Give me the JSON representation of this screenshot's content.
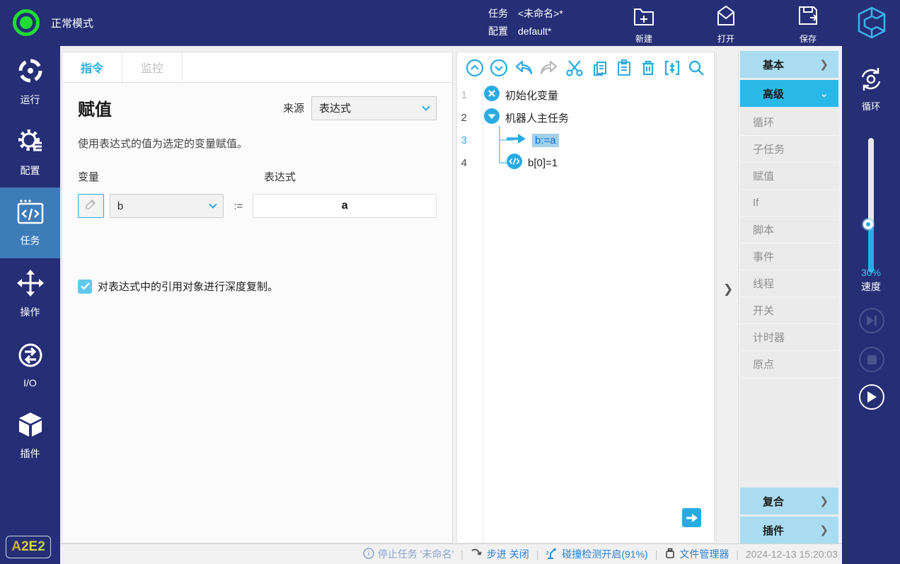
{
  "topbar": {
    "mode": "正常模式",
    "task_label": "任务",
    "task_value": "<未命名>*",
    "config_label": "配置",
    "config_value": "default*",
    "actions": [
      {
        "label": "新建"
      },
      {
        "label": "打开"
      },
      {
        "label": "保存"
      }
    ]
  },
  "sidebar": {
    "items": [
      {
        "label": "运行"
      },
      {
        "label": "配置"
      },
      {
        "label": "任务"
      },
      {
        "label": "操作"
      },
      {
        "label": "I/O"
      },
      {
        "label": "插件"
      }
    ],
    "badge": "A2E2"
  },
  "form": {
    "tabs": [
      {
        "label": "指令"
      },
      {
        "label": "监控"
      }
    ],
    "title": "赋值",
    "source_label": "来源",
    "source_value": "表达式",
    "description": "使用表达式的值为选定的变量赋值。",
    "variable_label": "变量",
    "expression_label": "表达式",
    "variable_value": "b",
    "assign_symbol": ":=",
    "expression_value": "a",
    "checkbox_label": "对表达式中的引用对象进行深度复制。",
    "checkbox_checked": true
  },
  "tree": {
    "toolbar_icons": [
      "move-up",
      "move-down",
      "undo",
      "redo",
      "cut",
      "copy",
      "paste",
      "delete",
      "collapse",
      "search"
    ],
    "rows": [
      {
        "num": "1",
        "icon": "init-variable-icon",
        "label": "初始化变量"
      },
      {
        "num": "2",
        "icon": "main-task-icon",
        "label": "机器人主任务"
      },
      {
        "num": "3",
        "icon": "assign-arrow-icon",
        "label": "b:=a",
        "selected": true
      },
      {
        "num": "4",
        "icon": "script-icon",
        "label": "b[0]=1"
      }
    ]
  },
  "categories": {
    "groups": [
      {
        "label": "基本"
      },
      {
        "label": "高级"
      }
    ],
    "items": [
      "循环",
      "子任务",
      "赋值",
      "If",
      "脚本",
      "事件",
      "线程",
      "开关",
      "计时器",
      "原点"
    ],
    "bottom_groups": [
      {
        "label": "复合"
      },
      {
        "label": "插件"
      }
    ]
  },
  "right_panel": {
    "loop_label": "循环",
    "speed_value": "30%",
    "speed_label": "速度"
  },
  "status_bar": {
    "stop_task": "停止任务 '未命名'",
    "step_label": "步进 关闭",
    "collision": "碰撞检测开启(91%)",
    "file_manager": "文件管理器",
    "timestamp": "2024-12-13 15:20:03"
  },
  "colors": {
    "accent": "#29abe2",
    "navy": "#262e76",
    "sidebar_active": "#3e7cb9",
    "category_active": "#29b9e8",
    "category_light": "#a9dcf0",
    "mode_green": "#1fdd35",
    "tree_selection": "#a2d0eb"
  }
}
